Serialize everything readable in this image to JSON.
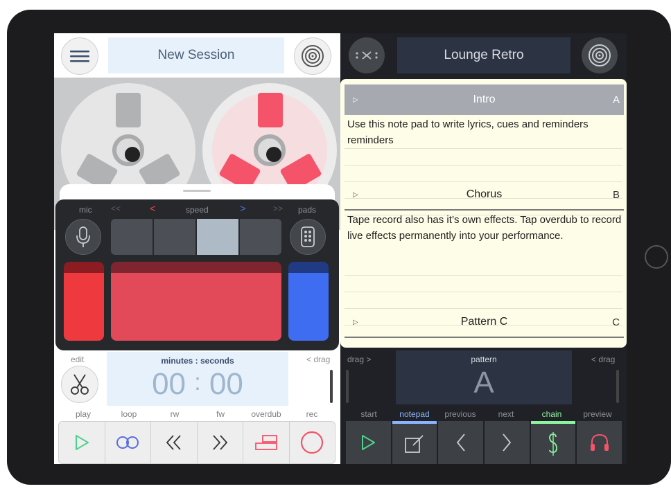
{
  "left": {
    "session_title": "New Session",
    "mixer": {
      "mic_label": "mic",
      "speed_label": "speed",
      "pads_label": "pads",
      "rewind_arrows": "<<",
      "prev_arrow": "<",
      "next_arrow": ">",
      "ff_arrows": ">>"
    },
    "time": {
      "edit_label": "edit",
      "header": "minutes : seconds",
      "minutes": "00",
      "separator": ":",
      "seconds": "00",
      "drag_label": "< drag"
    },
    "transport": {
      "play": "play",
      "loop": "loop",
      "rw": "rw",
      "fw": "fw",
      "overdub": "overdub",
      "rec": "rec"
    }
  },
  "right": {
    "project_title": "Lounge Retro",
    "notes": [
      {
        "title": "Intro",
        "letter": "A",
        "text": "Use this note pad to write lyrics, cues and reminders reminders"
      },
      {
        "title": "Chorus",
        "letter": "B",
        "text": "Tape record also has it’s own effects. Tap overdub to record live effects permanently into your performance."
      },
      {
        "title": "Pattern C",
        "letter": "C",
        "text": ""
      }
    ],
    "pattern": {
      "drag_left": "drag >",
      "label": "pattern",
      "value": "A",
      "drag_right": "< drag"
    },
    "transport": {
      "start": "start",
      "notepad": "notepad",
      "previous": "previous",
      "next": "next",
      "chain": "chain",
      "preview": "preview"
    }
  },
  "colors": {
    "accent_red": "#f4536a",
    "pad_red": "#ee3a3f",
    "pad_pink": "#e24a5a",
    "pad_blue": "#3f6df1",
    "play_green": "#4fd08c",
    "loop_blue": "#5a6ee0",
    "notepad_blue": "#8ab4ff",
    "chain_green": "#8bf5a0"
  }
}
